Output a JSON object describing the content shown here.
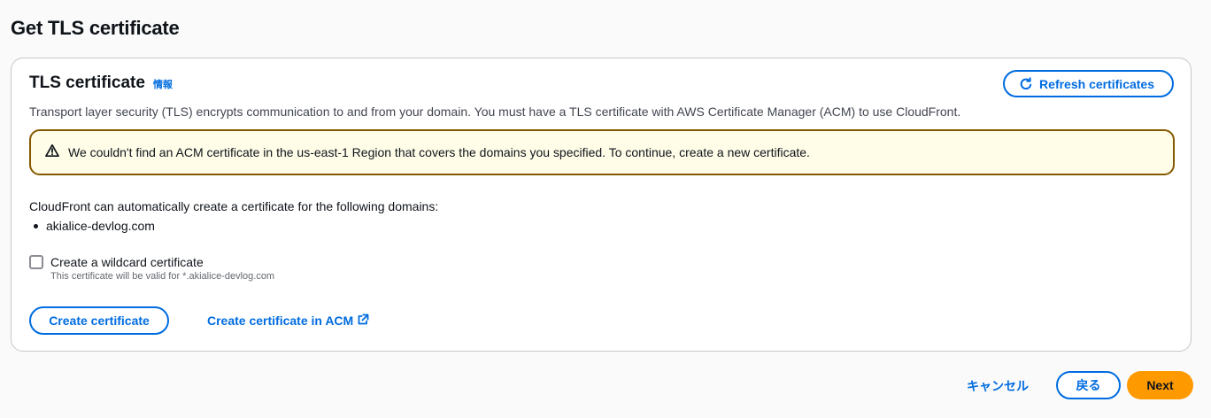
{
  "page": {
    "title": "Get TLS certificate"
  },
  "card": {
    "title": "TLS certificate",
    "info_link": "情報",
    "refresh_button": "Refresh certificates",
    "description": "Transport layer security (TLS) encrypts communication to and from your domain. You must have a TLS certificate with AWS Certificate Manager (ACM) to use CloudFront."
  },
  "alert": {
    "icon": "warning-icon",
    "text": "We couldn't find an ACM certificate in the us-east-1 Region that covers the domains you specified. To continue, create a new certificate.",
    "type": "warning"
  },
  "domains": {
    "label": "CloudFront can automatically create a certificate for the following domains:",
    "items": [
      "akialice-devlog.com"
    ]
  },
  "wildcard": {
    "label": "Create a wildcard certificate",
    "description": "This certificate will be valid for *.akialice-devlog.com",
    "checked": false
  },
  "actions": {
    "create_certificate": "Create certificate",
    "create_in_acm": "Create certificate in ACM"
  },
  "footer": {
    "cancel": "キャンセル",
    "back": "戻る",
    "next": "Next"
  },
  "colors": {
    "link": "#006ce0",
    "primary_button": "#ff9900",
    "warning_border": "#855900",
    "warning_background": "#fffce8"
  }
}
